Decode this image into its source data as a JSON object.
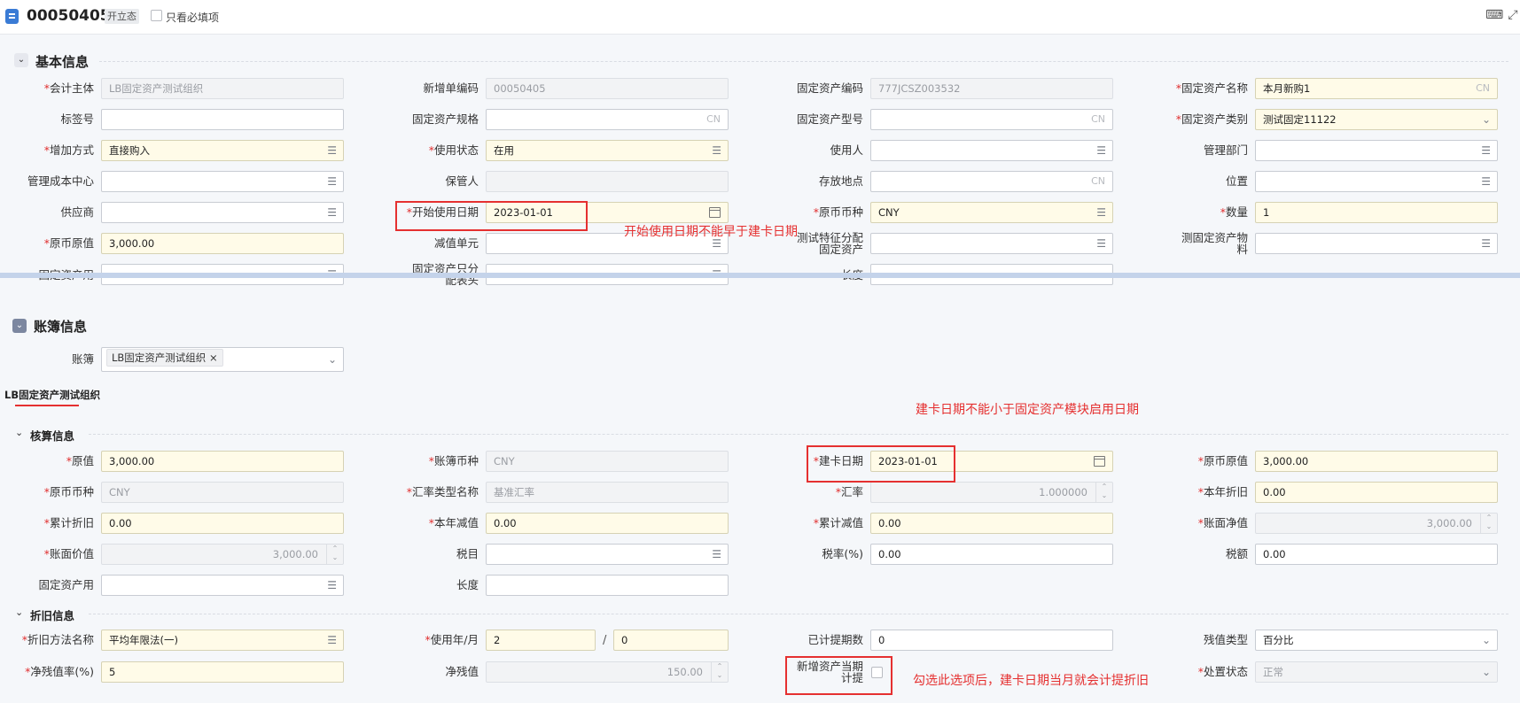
{
  "header": {
    "doc_no": "00050405",
    "status": "开立态",
    "only_required": "只看必填项"
  },
  "basic": {
    "title": "基本信息",
    "accounting_entity": {
      "label": "会计主体",
      "value": "LB固定资产测试组织"
    },
    "new_code": {
      "label": "新增单编码",
      "value": "00050405"
    },
    "asset_code": {
      "label": "固定资产编码",
      "value": "777JCSZ003532"
    },
    "asset_name": {
      "label": "固定资产名称",
      "value": "本月新购1",
      "suffix": "CN"
    },
    "tag_no": {
      "label": "标签号",
      "value": ""
    },
    "spec": {
      "label": "固定资产规格",
      "suffix": "CN"
    },
    "model": {
      "label": "固定资产型号",
      "suffix": "CN"
    },
    "category": {
      "label": "固定资产类别",
      "value": "测试固定11122"
    },
    "add_method": {
      "label": "增加方式",
      "value": "直接购入"
    },
    "use_status": {
      "label": "使用状态",
      "value": "在用"
    },
    "user": {
      "label": "使用人"
    },
    "dept": {
      "label": "管理部门"
    },
    "cost_center": {
      "label": "管理成本中心"
    },
    "custodian": {
      "label": "保管人"
    },
    "location": {
      "label": "存放地点",
      "suffix": "CN"
    },
    "position": {
      "label": "位置"
    },
    "supplier": {
      "label": "供应商"
    },
    "start_date": {
      "label": "开始使用日期",
      "value": "2023-01-01"
    },
    "currency": {
      "label": "原币币种",
      "value": "CNY"
    },
    "qty": {
      "label": "数量",
      "value": "1"
    },
    "orig_value": {
      "label": "原币原值",
      "value": "3,000.00"
    },
    "impair_unit": {
      "label": "减值单元"
    },
    "feature_label_1": "测试特征分配",
    "feature_label_2": "固定资产",
    "material_label_1": "测固定资产物",
    "material_label_2": "料",
    "asset_use": {
      "label": "固定资产用"
    },
    "alloc_label_1": "固定资产只分",
    "alloc_label_2": "配表头",
    "length": {
      "label": "长度"
    }
  },
  "annotations": {
    "start_date_note": "开始使用日期不能早于建卡日期",
    "card_date_note": "建卡日期不能小于固定资产模块启用日期",
    "checkbox_note": "勾选此选项后，建卡日期当月就会计提折旧"
  },
  "books": {
    "title": "账簿信息",
    "book_label": "账簿",
    "book_tag": "LB固定资产测试组织",
    "tab": "LB固定资产测试组织"
  },
  "accounting": {
    "title": "核算信息",
    "value": {
      "label": "原值",
      "value": "3,000.00"
    },
    "book_currency": {
      "label": "账簿币种",
      "value": "CNY"
    },
    "card_date": {
      "label": "建卡日期",
      "value": "2023-01-01"
    },
    "orig_value": {
      "label": "原币原值",
      "value": "3,000.00"
    },
    "orig_currency": {
      "label": "原币币种",
      "value": "CNY"
    },
    "rate_type": {
      "label": "汇率类型名称",
      "value": "基准汇率"
    },
    "rate": {
      "label": "汇率",
      "value": "1.000000"
    },
    "year_depr": {
      "label": "本年折旧",
      "value": "0.00"
    },
    "accum_depr": {
      "label": "累计折旧",
      "value": "0.00"
    },
    "year_impair": {
      "label": "本年减值",
      "value": "0.00"
    },
    "accum_impair": {
      "label": "累计减值",
      "value": "0.00"
    },
    "net_book": {
      "label": "账面净值",
      "value": "3,000.00"
    },
    "book_value": {
      "label": "账面价值",
      "value": "3,000.00"
    },
    "tax_item": {
      "label": "税目"
    },
    "tax_rate": {
      "label": "税率(%)",
      "value": "0.00"
    },
    "tax_amount": {
      "label": "税额",
      "value": "0.00"
    },
    "asset_use": {
      "label": "固定资产用"
    },
    "length": {
      "label": "长度"
    }
  },
  "depreciation": {
    "title": "折旧信息",
    "method": {
      "label": "折旧方法名称",
      "value": "平均年限法(一)"
    },
    "life": {
      "label": "使用年/月",
      "years": "2",
      "months": "0",
      "sep": "/"
    },
    "periods": {
      "label": "已计提期数",
      "value": "0"
    },
    "residual_type": {
      "label": "残值类型",
      "value": "百分比"
    },
    "residual_rate": {
      "label": "净残值率(%)",
      "value": "5"
    },
    "residual_value": {
      "label": "净残值",
      "value": "150.00"
    },
    "new_asset_label_1": "新增资产当期",
    "new_asset_label_2": "计提",
    "disposal": {
      "label": "处置状态",
      "value": "正常"
    }
  }
}
